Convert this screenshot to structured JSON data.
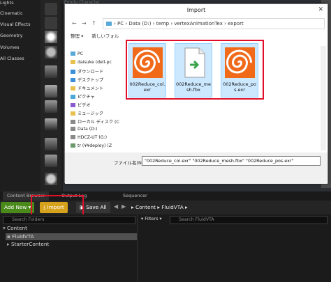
{
  "editor": {
    "place_categories": [
      "Lights",
      "Cinematic",
      "Visual Effects",
      "Geometry",
      "Volumes",
      "All Classes"
    ],
    "viewport_label": "Empty Character"
  },
  "dialog": {
    "title": "Import",
    "address": {
      "back_icon": "arrow-left-icon",
      "forward_icon": "arrow-right-icon",
      "up_icon": "arrow-up-icon",
      "path": "›  PC  ›  Data (D:)  ›  temp  ›  vertexAnimationTex  ›  export"
    },
    "toolbar": {
      "organize": "整理 ▾",
      "new_folder": "新しいフォル"
    },
    "nav_items": [
      "PC",
      "daisuke (dell-pc",
      "ダウンロード",
      "デスクトップ",
      "ドキュメント",
      "ピクチャ",
      "ビデオ",
      "ミュージック",
      "ローカル ディスク (C",
      "Data (D:)",
      "HDCZ-UT (G:)",
      "tr (¥¥deploy) (Z"
    ],
    "files": [
      {
        "name": "002Reduce_col.exr",
        "icon": "houdini-icon",
        "color": "#f06a1a"
      },
      {
        "name": "002Reduce_mesh.fbx",
        "icon": "fbx-file-icon",
        "color": "#3aa34a"
      },
      {
        "name": "002Reduce_pos.exr",
        "icon": "houdini-icon",
        "color": "#f06a1a"
      }
    ],
    "filename_label": "ファイル名(N):",
    "filename_value": "\"002Reduce_col.exr\" \"002Reduce_mesh.fbx\" \"002Reduce_pos.exr\""
  },
  "tabs": [
    "Content Browser",
    "Output Log",
    "Sequencer"
  ],
  "content_browser": {
    "add_new": "Add New ▾",
    "import": "Import",
    "save_all": "Save All",
    "breadcrumb": "▸  Content  ▸  FluidVTA  ▸",
    "folder_search_placeholder": "Search Folders",
    "tree": [
      "Content",
      "FluidVTA",
      "StarterContent"
    ],
    "filters": "▾ Filters ▾",
    "asset_search_placeholder": "Search FluidVTA"
  },
  "colors": {
    "highlight": "#e0102a",
    "import_button": "#d6a21b",
    "add_new_button": "#4a8a1b"
  }
}
